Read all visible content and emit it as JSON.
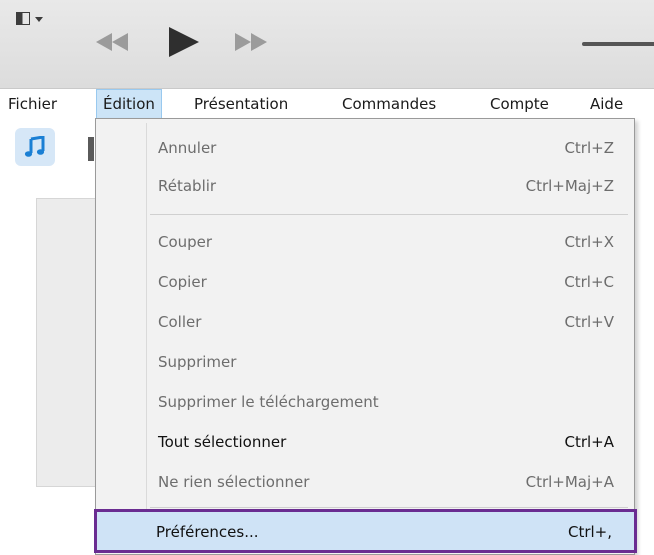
{
  "toolbar": {
    "window_menu_icon": "window-layout-icon",
    "controls": [
      "rewind-icon",
      "play-icon",
      "fast-forward-icon"
    ]
  },
  "menubar": {
    "items": [
      {
        "label": "Fichier"
      },
      {
        "label": "Édition"
      },
      {
        "label": "Présentation"
      },
      {
        "label": "Commandes"
      },
      {
        "label": "Compte"
      },
      {
        "label": "Aide"
      }
    ],
    "active": "Édition"
  },
  "edit_menu": {
    "items": [
      {
        "label": "Annuler",
        "shortcut": "Ctrl+Z",
        "enabled": false
      },
      {
        "label": "Rétablir",
        "shortcut": "Ctrl+Maj+Z",
        "enabled": false
      },
      {
        "label": "Couper",
        "shortcut": "Ctrl+X",
        "enabled": false
      },
      {
        "label": "Copier",
        "shortcut": "Ctrl+C",
        "enabled": false
      },
      {
        "label": "Coller",
        "shortcut": "Ctrl+V",
        "enabled": false
      },
      {
        "label": "Supprimer",
        "shortcut": "",
        "enabled": false
      },
      {
        "label": "Supprimer le téléchargement",
        "shortcut": "",
        "enabled": false
      },
      {
        "label": "Tout sélectionner",
        "shortcut": "Ctrl+A",
        "enabled": true
      },
      {
        "label": "Ne rien sélectionner",
        "shortcut": "Ctrl+Maj+A",
        "enabled": false
      },
      {
        "label": "Préférences...",
        "shortcut": "Ctrl+,",
        "enabled": true,
        "highlighted": true
      }
    ]
  },
  "colors": {
    "highlight_border": "#6a2c91",
    "highlight_fill": "#cfe3f6",
    "active_menu_fill": "#cce4f7",
    "music_icon": "#1a7fd4"
  },
  "library": {
    "icon": "music-note-icon"
  }
}
